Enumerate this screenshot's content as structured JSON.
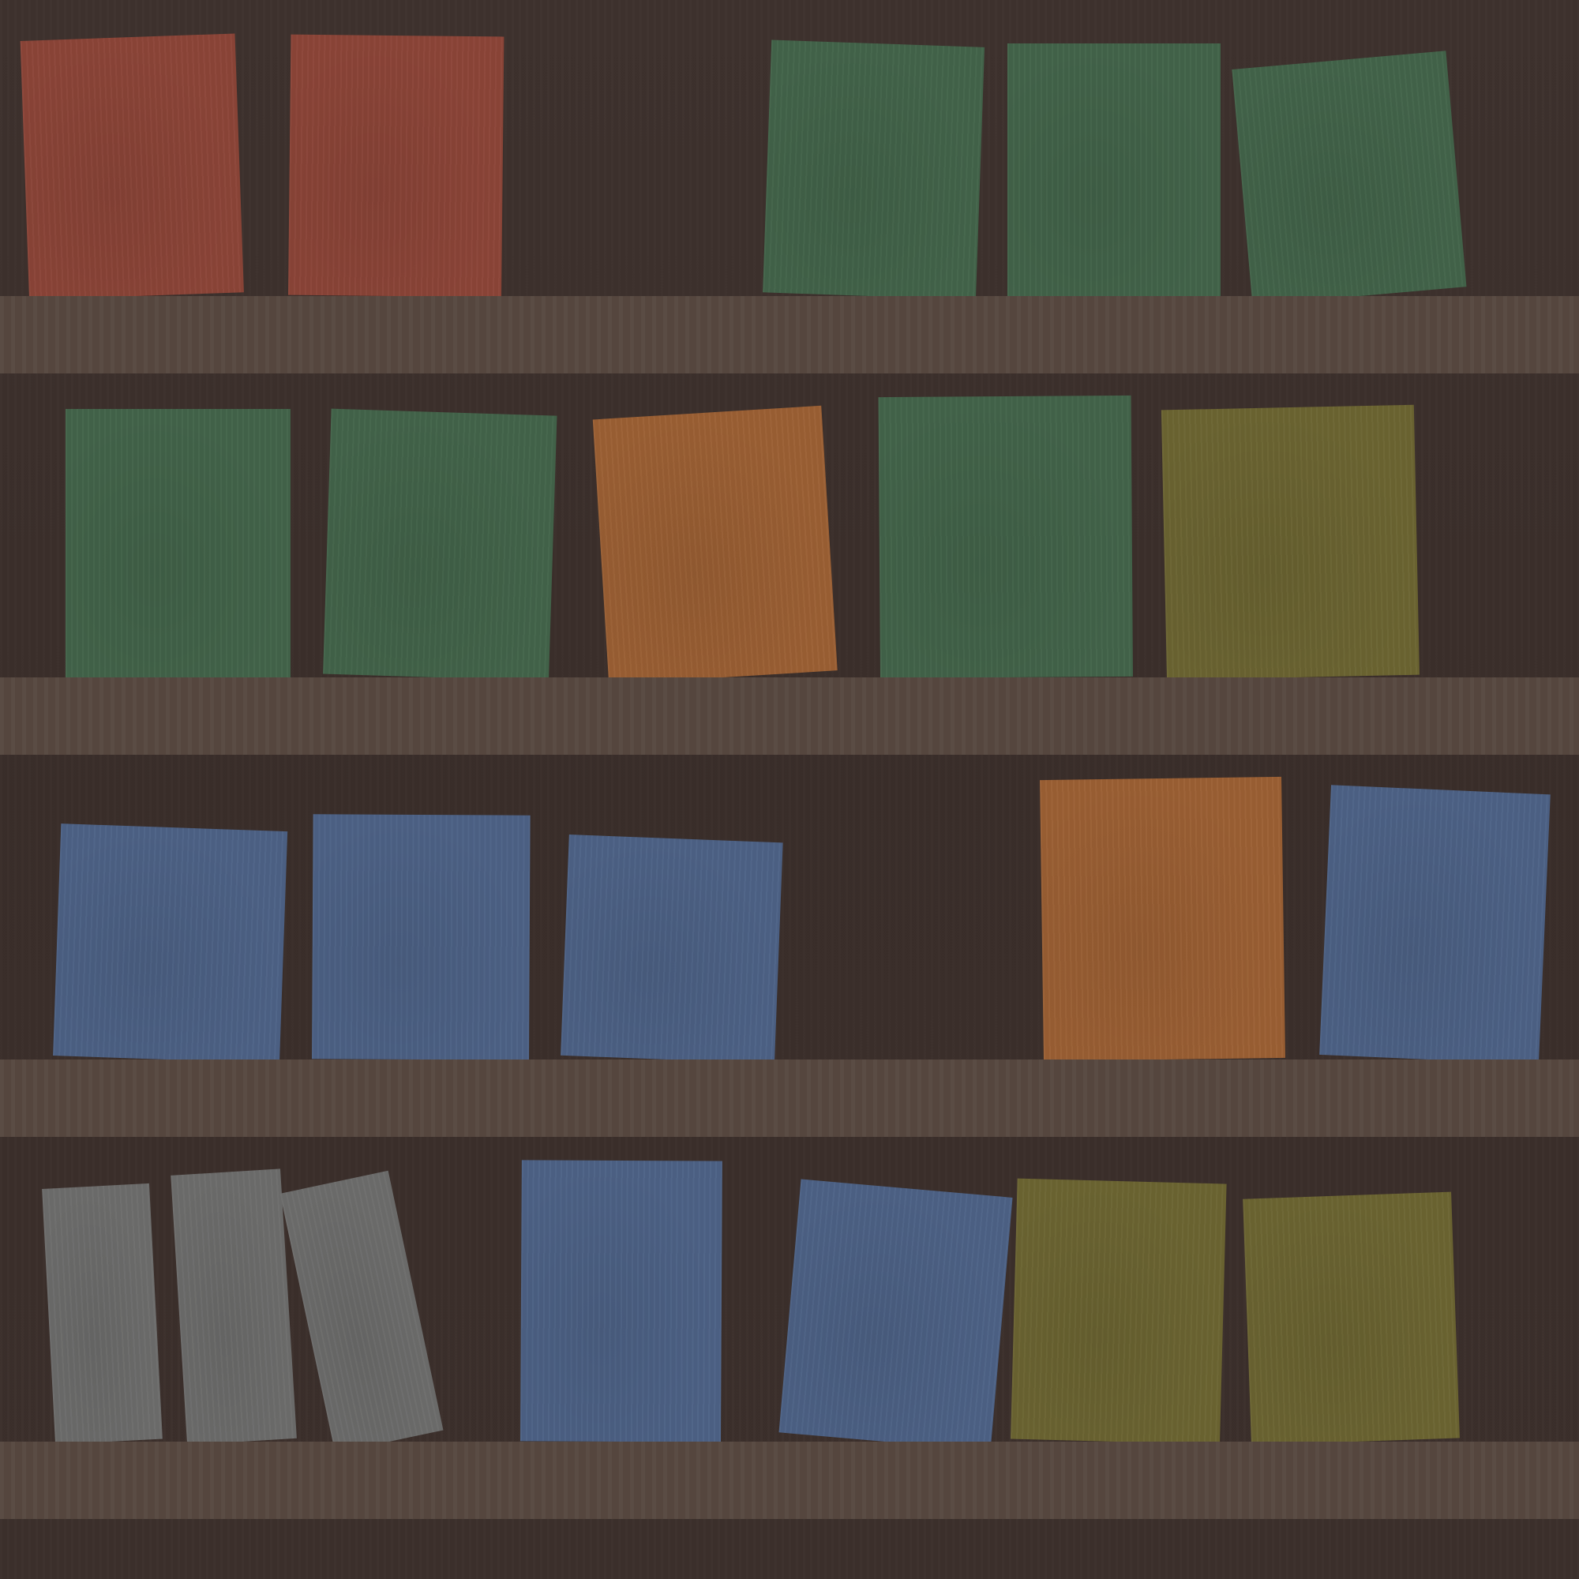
{
  "palette": {
    "red": "#8c4538",
    "green": "#43644a",
    "orange": "#9c6034",
    "olive": "#6c6532",
    "blue": "#4d6286",
    "gray": "#6d6d6c",
    "wall": "#3b2f2b",
    "shelf": "#574840"
  },
  "shelves": [
    {
      "books": [
        {
          "color": "red"
        },
        {
          "color": "red"
        },
        {
          "color": "green"
        },
        {
          "color": "green"
        },
        {
          "color": "green"
        }
      ]
    },
    {
      "books": [
        {
          "color": "green"
        },
        {
          "color": "green"
        },
        {
          "color": "orange"
        },
        {
          "color": "green"
        },
        {
          "color": "olive"
        }
      ]
    },
    {
      "books": [
        {
          "color": "blue"
        },
        {
          "color": "blue"
        },
        {
          "color": "blue"
        },
        {
          "color": "orange"
        },
        {
          "color": "blue"
        }
      ]
    },
    {
      "books": [
        {
          "color": "gray"
        },
        {
          "color": "gray"
        },
        {
          "color": "gray"
        },
        {
          "color": "blue"
        },
        {
          "color": "blue"
        },
        {
          "color": "olive"
        },
        {
          "color": "olive"
        }
      ]
    }
  ]
}
